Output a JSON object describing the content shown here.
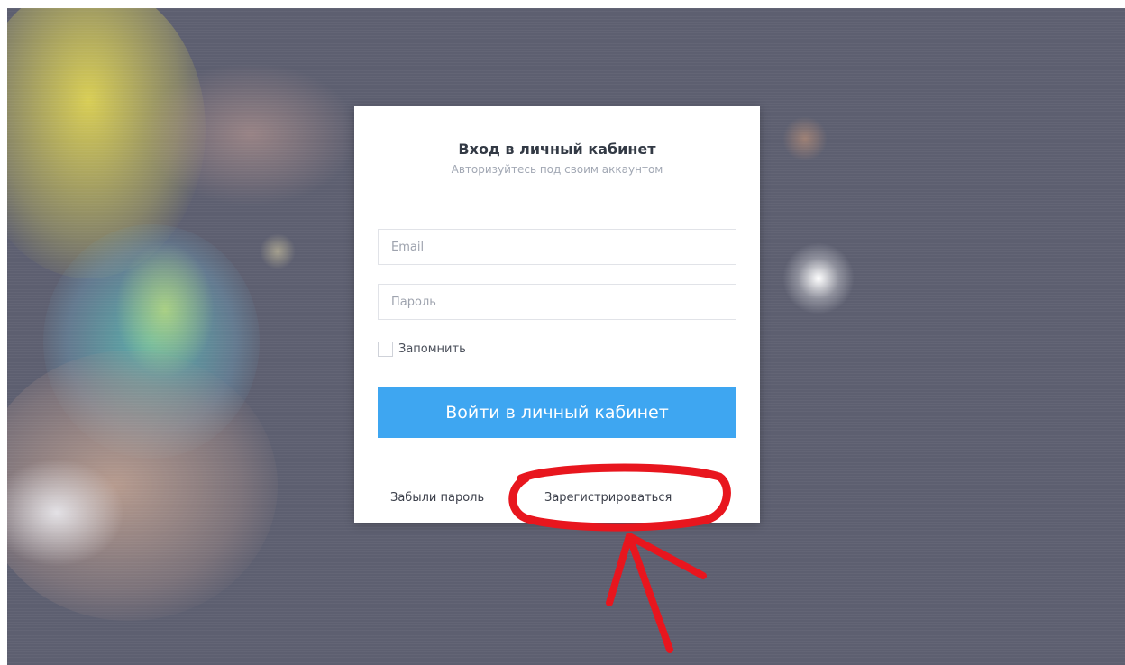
{
  "login_card": {
    "title": "Вход в личный кабинет",
    "subtitle": "Авторизуйтесь под своим аккаунтом",
    "email_placeholder": "Email",
    "password_placeholder": "Пароль",
    "remember_label": "Запомнить",
    "submit_label": "Войти в личный кабинет",
    "forgot_label": "Забыли пароль",
    "register_label": "Зарегистрироваться",
    "accent_color": "#3ea6f1"
  },
  "annotation": {
    "color": "#e8161e",
    "shapes": [
      "ellipse",
      "arrow"
    ]
  }
}
